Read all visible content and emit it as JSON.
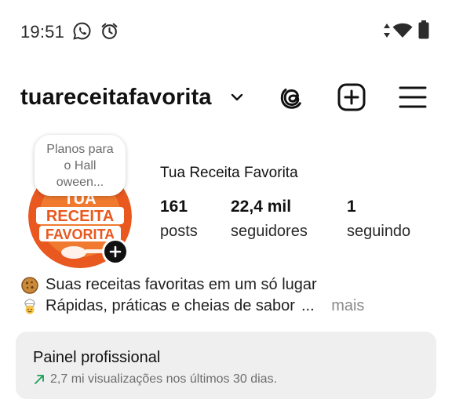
{
  "status_bar": {
    "time": "19:51",
    "icons": [
      "whatsapp-icon",
      "alarm-icon",
      "data-arrows-icon",
      "wifi-icon",
      "battery-icon"
    ]
  },
  "header": {
    "username": "tuareceitafavorita",
    "icons": [
      "chevron-down-icon",
      "threads-icon",
      "add-post-icon",
      "menu-icon"
    ]
  },
  "profile": {
    "note": "Planos para o Hall oween...",
    "avatar_text": [
      "TUA",
      "RECEITA",
      "FAVORITA"
    ],
    "display_name": "Tua Receita Favorita",
    "stats": [
      {
        "value": "161",
        "label": "posts"
      },
      {
        "value": "22,4 mil",
        "label": "seguidores"
      },
      {
        "value": "1",
        "label": "seguindo"
      }
    ]
  },
  "bio": {
    "line1": "Suas receitas favoritas em um só lugar",
    "line2": "Rápidas, práticas e cheias de sabor",
    "ellipsis": "...",
    "more": "mais"
  },
  "panel": {
    "title": "Painel profissional",
    "subtitle": "2,7 mi visualizações nos últimos 30 dias."
  },
  "colors": {
    "accent_green": "#1a9e5a",
    "avatar_orange": "#e8581f",
    "panel_bg": "#efefef",
    "text_muted": "#6e6e6e"
  }
}
